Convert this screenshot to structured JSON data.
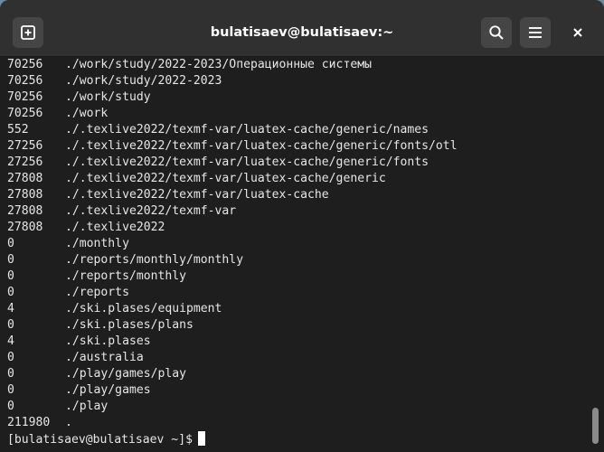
{
  "window": {
    "title": "bulatisaev@bulatisaev:~"
  },
  "toolbar": {
    "new_tab_icon": "new-tab-icon",
    "search_icon": "search-icon",
    "menu_icon": "hamburger-menu-icon",
    "close_icon": "close-icon"
  },
  "terminal": {
    "lines": [
      {
        "size": "70256",
        "path": "./work/study/2022-2023/Операционные системы"
      },
      {
        "size": "70256",
        "path": "./work/study/2022-2023"
      },
      {
        "size": "70256",
        "path": "./work/study"
      },
      {
        "size": "70256",
        "path": "./work"
      },
      {
        "size": "552",
        "path": "./.texlive2022/texmf-var/luatex-cache/generic/names"
      },
      {
        "size": "27256",
        "path": "./.texlive2022/texmf-var/luatex-cache/generic/fonts/otl"
      },
      {
        "size": "27256",
        "path": "./.texlive2022/texmf-var/luatex-cache/generic/fonts"
      },
      {
        "size": "27808",
        "path": "./.texlive2022/texmf-var/luatex-cache/generic"
      },
      {
        "size": "27808",
        "path": "./.texlive2022/texmf-var/luatex-cache"
      },
      {
        "size": "27808",
        "path": "./.texlive2022/texmf-var"
      },
      {
        "size": "27808",
        "path": "./.texlive2022"
      },
      {
        "size": "0",
        "path": "./monthly"
      },
      {
        "size": "0",
        "path": "./reports/monthly/monthly"
      },
      {
        "size": "0",
        "path": "./reports/monthly"
      },
      {
        "size": "0",
        "path": "./reports"
      },
      {
        "size": "4",
        "path": "./ski.plases/equipment"
      },
      {
        "size": "0",
        "path": "./ski.plases/plans"
      },
      {
        "size": "4",
        "path": "./ski.plases"
      },
      {
        "size": "0",
        "path": "./australia"
      },
      {
        "size": "0",
        "path": "./play/games/play"
      },
      {
        "size": "0",
        "path": "./play/games"
      },
      {
        "size": "0",
        "path": "./play"
      },
      {
        "size": "211980",
        "path": "."
      }
    ],
    "prompt": "[bulatisaev@bulatisaev ~]$"
  }
}
